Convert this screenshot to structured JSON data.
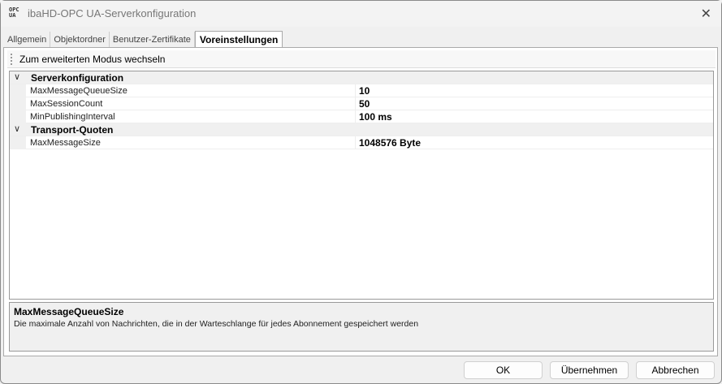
{
  "window": {
    "logo_text": "OPC UA",
    "title": "ibaHD-OPC UA-Serverkonfiguration",
    "close_icon": "close-icon"
  },
  "tabs": [
    {
      "label": "Allgemein"
    },
    {
      "label": "Objektordner"
    },
    {
      "label": "Benutzer-Zertifikate"
    },
    {
      "label": "Voreinstellungen",
      "active": true
    }
  ],
  "toolbar": {
    "mode_button": "Zum erweiterten Modus wechseln"
  },
  "grid": {
    "categories": [
      {
        "name": "Serverkonfiguration",
        "properties": [
          {
            "name": "MaxMessageQueueSize",
            "value": "10"
          },
          {
            "name": "MaxSessionCount",
            "value": "50"
          },
          {
            "name": "MinPublishingInterval",
            "value": "100 ms"
          }
        ]
      },
      {
        "name": "Transport-Quoten",
        "properties": [
          {
            "name": "MaxMessageSize",
            "value": "1048576 Byte"
          }
        ]
      }
    ]
  },
  "description": {
    "title": "MaxMessageQueueSize",
    "text": "Die maximale Anzahl von Nachrichten, die in der Warteschlange für jedes Abonnement gespeichert werden"
  },
  "buttons": {
    "ok": "OK",
    "apply": "Übernehmen",
    "cancel": "Abbrechen"
  }
}
